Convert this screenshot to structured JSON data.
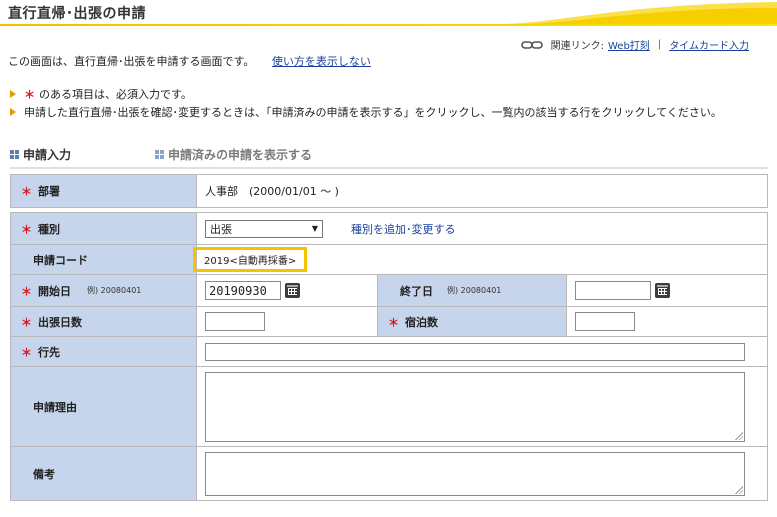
{
  "header": {
    "title": "直行直帰･出張の申請"
  },
  "related": {
    "label": "関連リンク:",
    "links": [
      "Web打刻",
      "タイムカード入力"
    ],
    "separator": "|"
  },
  "description": {
    "text": "この画面は、直行直帰･出張を申請する画面です。",
    "link": "使い方を表示しない"
  },
  "notes": {
    "required_mark": "＊",
    "line1": "のある項目は、必須入力です。",
    "line2": "申請した直行直帰･出張を確認･変更するときは、「申請済みの申請を表示する」をクリックし、一覧内の該当する行をクリックしてください。"
  },
  "tabs": [
    {
      "label": "申請入力",
      "active": true
    },
    {
      "label": "申請済みの申請を表示する",
      "active": false
    }
  ],
  "form": {
    "department": {
      "label": "部署",
      "value": "人事部　(2000/01/01 ～ )"
    },
    "category": {
      "label": "種別",
      "selected": "出張",
      "link": "種別を追加･変更する"
    },
    "code": {
      "label": "申請コード",
      "value": "2019<自動再採番>"
    },
    "start_date": {
      "label": "開始日",
      "example": "例) 20080401",
      "value": "20190930"
    },
    "end_date": {
      "label": "終了日",
      "example": "例) 20080401",
      "value": ""
    },
    "trip_days": {
      "label": "出張日数",
      "value": ""
    },
    "nights": {
      "label": "宿泊数",
      "value": ""
    },
    "destination": {
      "label": "行先",
      "value": ""
    },
    "reason": {
      "label": "申請理由",
      "value": ""
    },
    "remarks": {
      "label": "備考",
      "value": ""
    }
  },
  "colors": {
    "accent_yellow": "#f5c400",
    "label_bg": "#c6d5eb",
    "required_red": "#d8171e",
    "link_blue": "#1a3f9c"
  }
}
